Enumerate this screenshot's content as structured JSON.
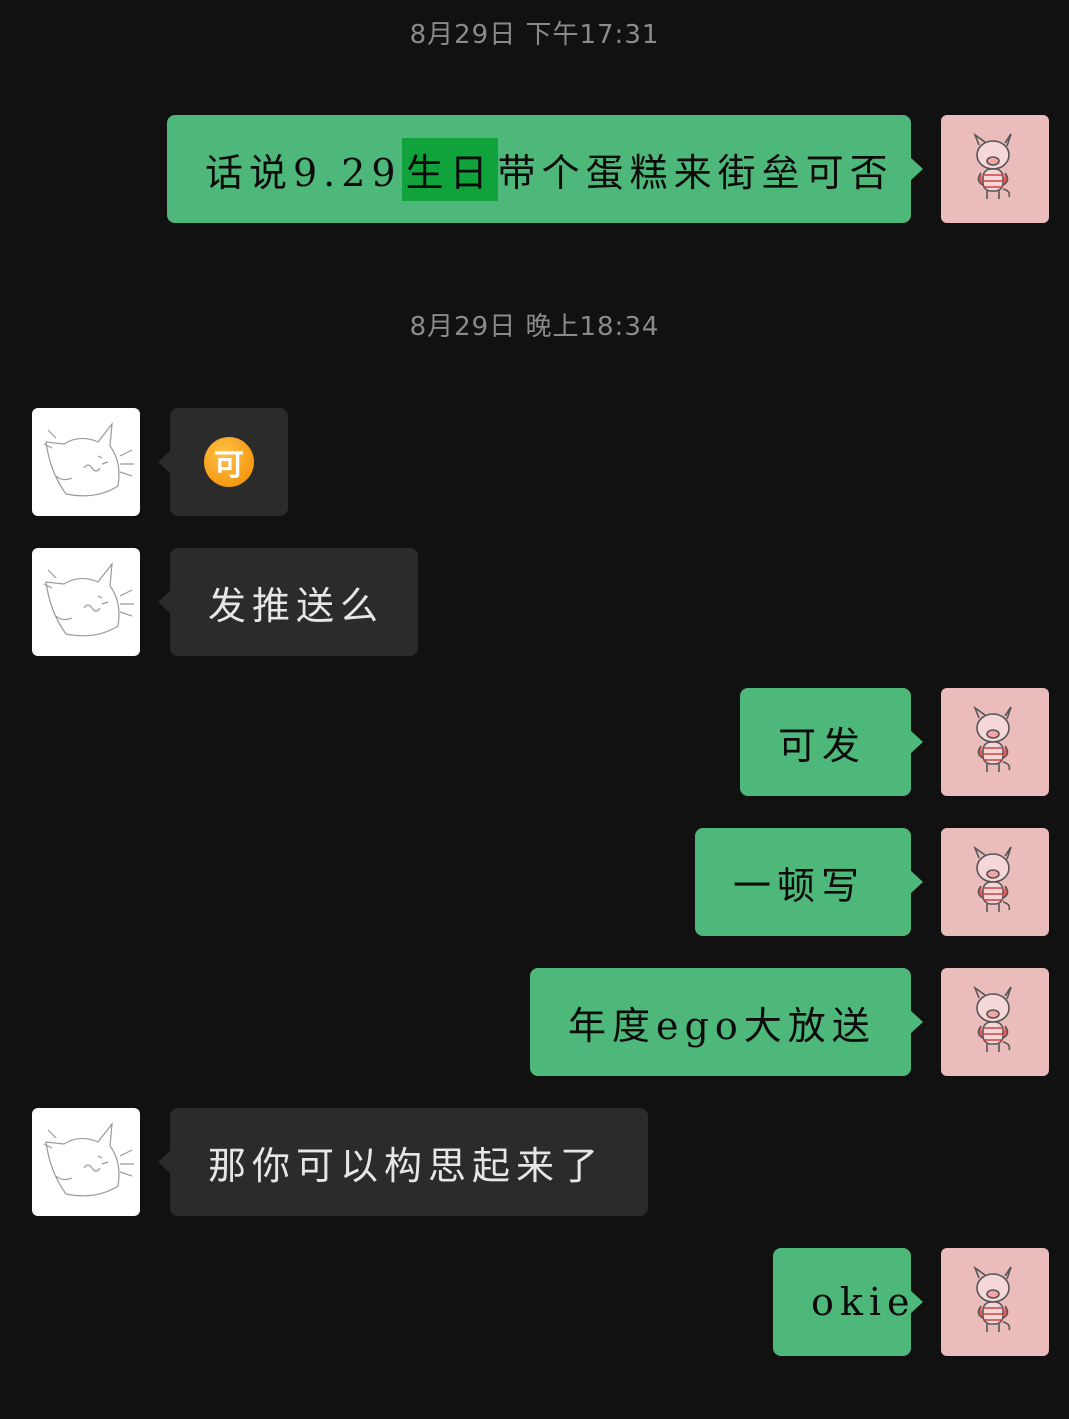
{
  "timestamps": [
    "8月29日  下午17:31",
    "8月29日  晚上18:34"
  ],
  "messages": [
    {
      "side": "me",
      "parts": [
        "话说9.29",
        "生日",
        "带个蛋糕来街垒可否"
      ],
      "highlight": "生日"
    },
    {
      "side": "them",
      "emoji": "可"
    },
    {
      "side": "them",
      "text": "发推送么"
    },
    {
      "side": "me",
      "text": "可发"
    },
    {
      "side": "me",
      "text": "一顿写"
    },
    {
      "side": "me",
      "text": "年度ego大放送"
    },
    {
      "side": "them",
      "text": "那你可以构思起来了"
    },
    {
      "side": "me",
      "text": "okie"
    }
  ],
  "avatars": {
    "me": "pig-avatar-icon",
    "them": "cat-sketch-avatar-icon"
  },
  "colors": {
    "background": "#111111",
    "my_bubble": "#4eb87a",
    "their_bubble": "#2b2b2b",
    "highlight": "#10a33b",
    "emoji_orange": "#f59a12",
    "my_avatar_bg": "#ebbcbc"
  }
}
